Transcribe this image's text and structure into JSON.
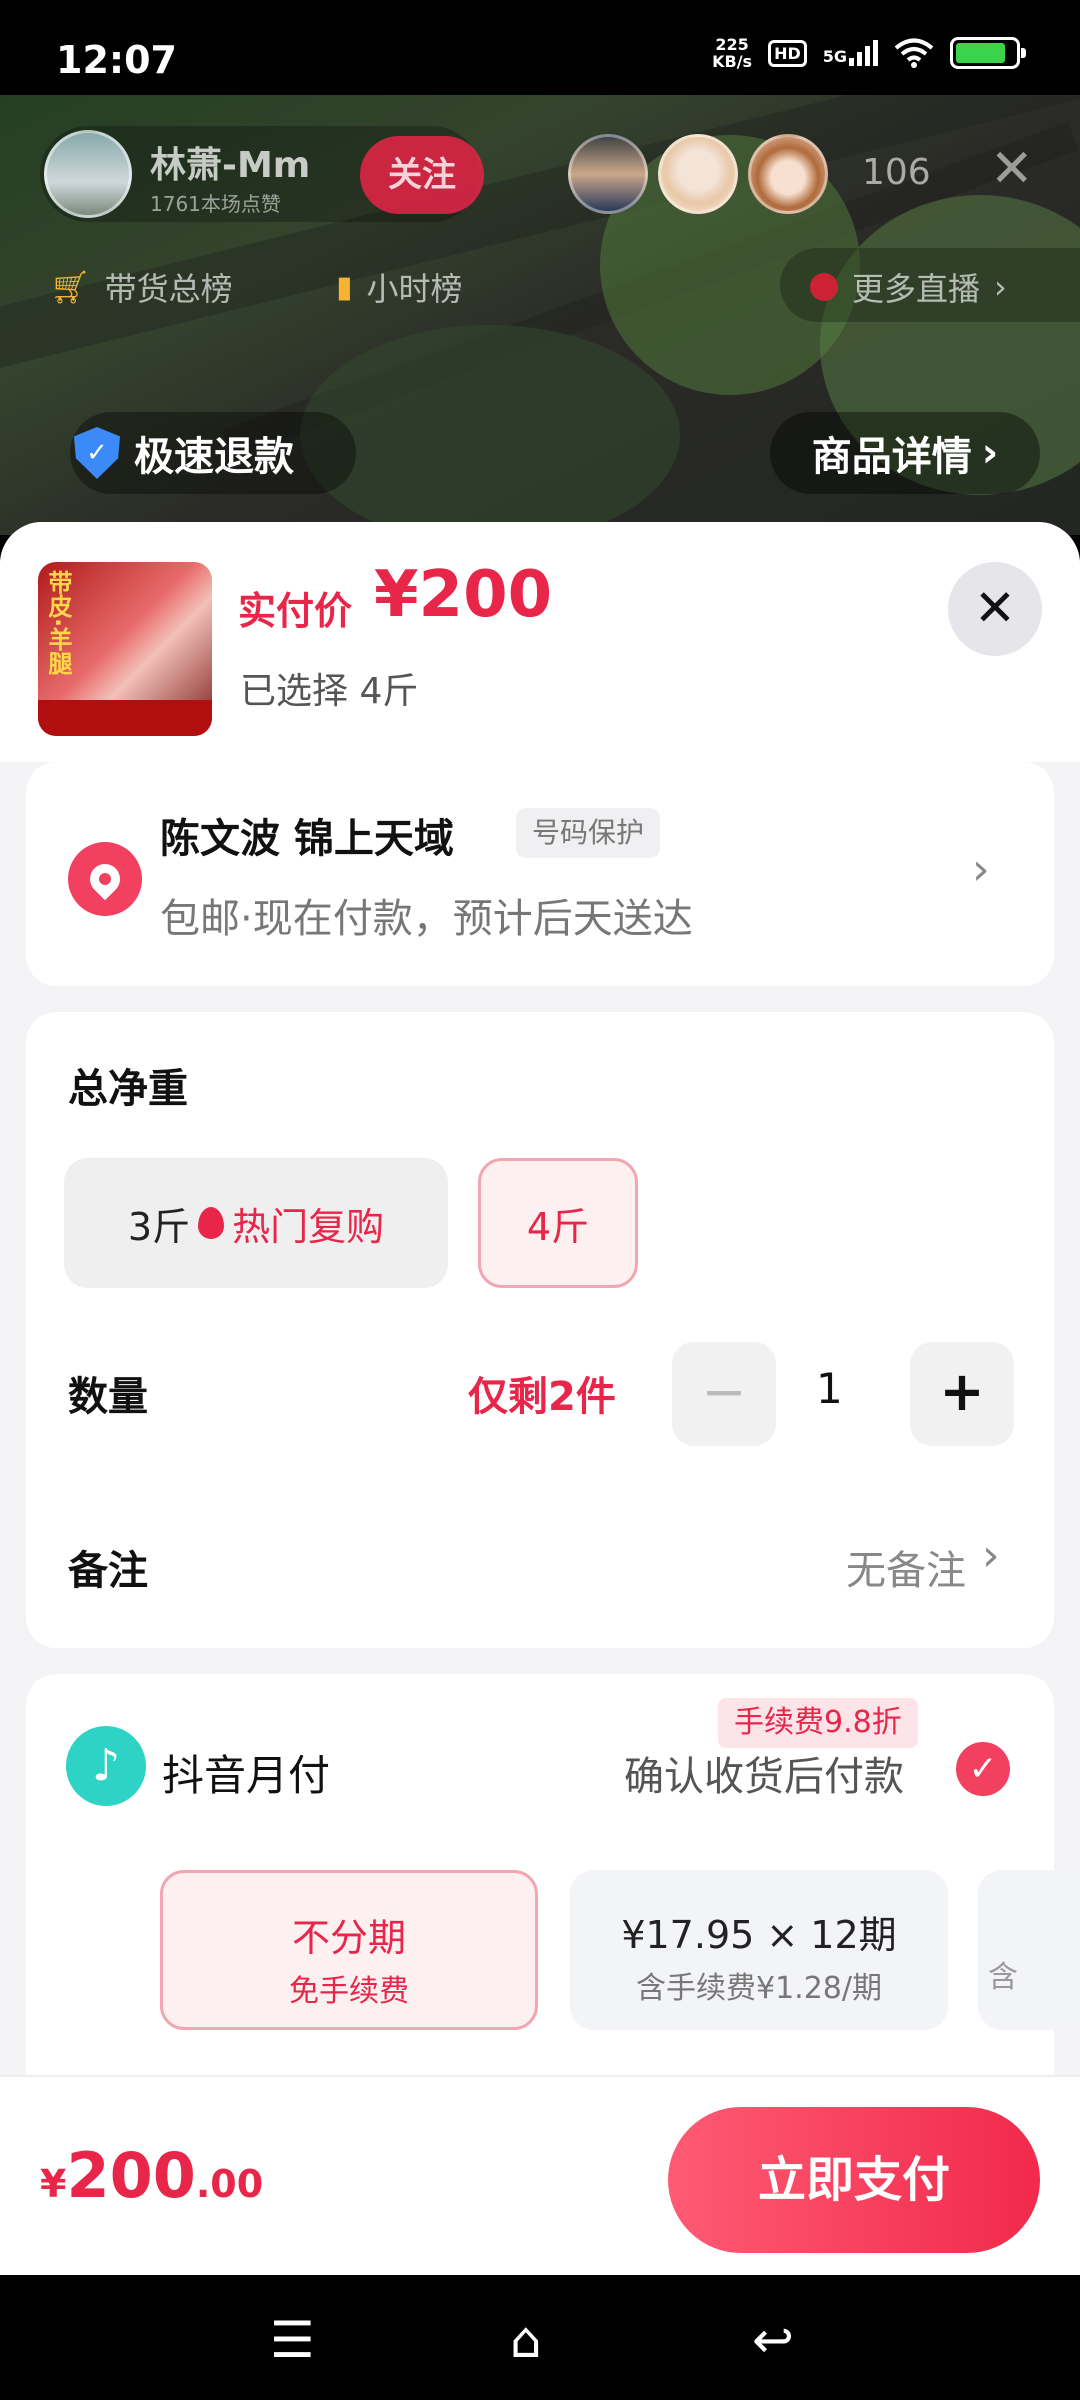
{
  "status_bar": {
    "time": "12:07",
    "net_speed_value": "225",
    "net_speed_unit": "KB/s",
    "hd": "HD",
    "network": "5G",
    "battery_level": 0.85
  },
  "live": {
    "host_name": "林萧-Mm",
    "host_likes": "1761本场点赞",
    "follow_label": "关注",
    "viewer_count": "106",
    "rank_sales": "带货总榜",
    "rank_hour": "小时榜",
    "more_live": "更多直播",
    "refund_tag": "极速退款",
    "detail_tag": "商品详情"
  },
  "product": {
    "price_label": "实付价",
    "price": "¥200",
    "selected": "已选择 4斤",
    "thumb_text": "带皮·羊腿"
  },
  "address": {
    "name": "陈文波  锦上天域",
    "privacy": "号码保护",
    "delivery": "包邮·现在付款，预计后天送达"
  },
  "options": {
    "weight_title": "总净重",
    "spec_3": "3斤",
    "spec_3_hot": "热门复购",
    "spec_4": "4斤",
    "quantity_title": "数量",
    "stock_left": "仅剩2件",
    "quantity": "1",
    "remark_title": "备注",
    "remark_value": "无备注"
  },
  "payment": {
    "method": "抖音月付",
    "note": "确认收货后付款",
    "plan_none_l1": "不分期",
    "plan_none_l2": "免手续费",
    "discount_badge": "手续费9.8折",
    "plan_12_l1": "¥17.95 × 12期",
    "plan_12_l2": "含手续费¥1.28/期",
    "plan_more_l2": "含"
  },
  "footer": {
    "total_symbol": "¥",
    "total_int": "200",
    "total_dec": ".00",
    "pay_label": "立即支付"
  },
  "colors": {
    "accent": "#e8264a",
    "douyin_pay": "#2dd3c4",
    "location": "#f24060"
  }
}
